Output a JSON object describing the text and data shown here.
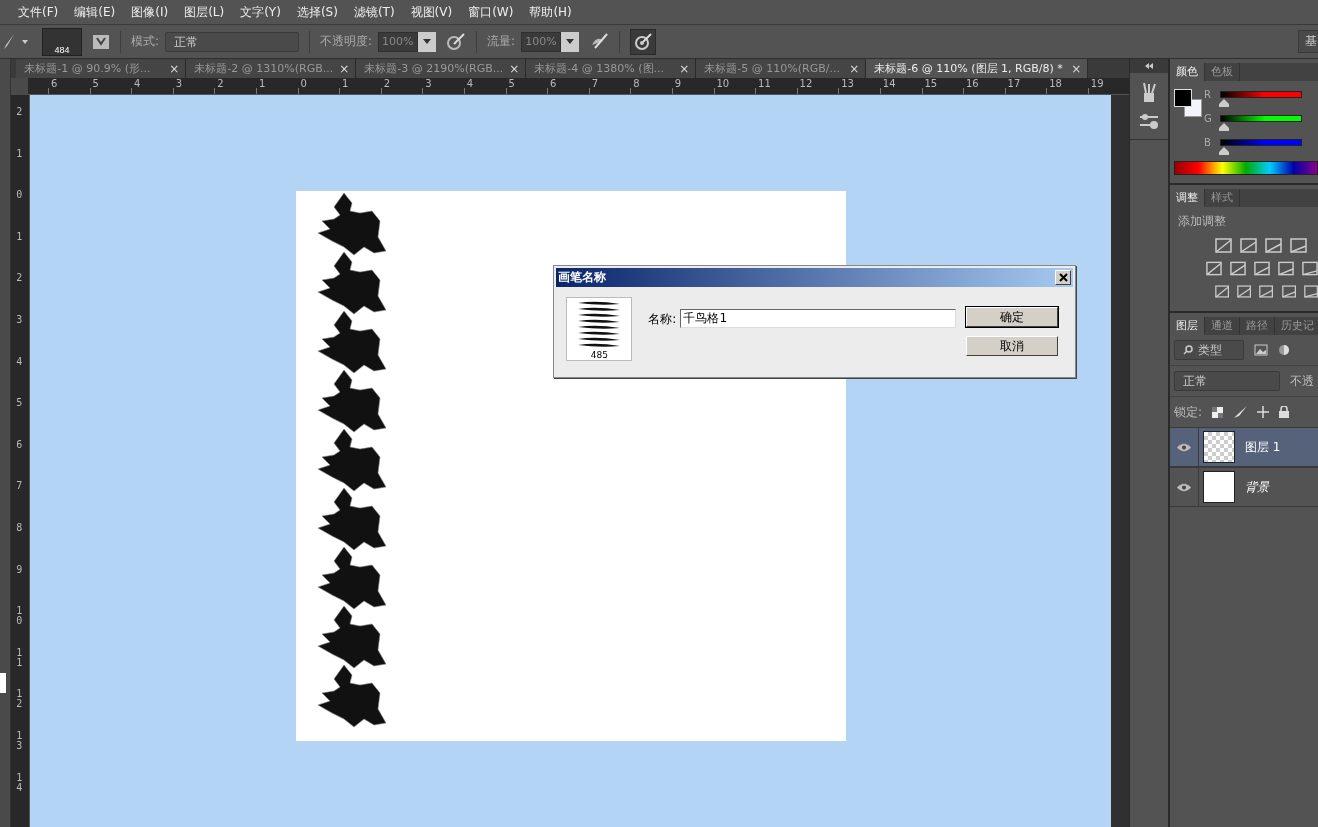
{
  "menu": [
    "文件(F)",
    "编辑(E)",
    "图像(I)",
    "图层(L)",
    "文字(Y)",
    "选择(S)",
    "滤镜(T)",
    "视图(V)",
    "窗口(W)",
    "帮助(H)"
  ],
  "options": {
    "brush_size": "484",
    "mode_label": "模式:",
    "mode": "正常",
    "opacity_label": "不透明度:",
    "opacity": "100%",
    "flow_label": "流量:",
    "flow": "100%",
    "workspace": "基"
  },
  "tabs": [
    {
      "label": "未标题-1 @ 90.9% (形...",
      "close": "×",
      "selected": false
    },
    {
      "label": "未标题-2 @ 1310%(RGB...",
      "close": "×",
      "selected": false
    },
    {
      "label": "未标题-3 @ 2190%(RGB...",
      "close": "×",
      "selected": false
    },
    {
      "label": "未标题-4 @ 1380% (图...",
      "close": "×",
      "selected": false
    },
    {
      "label": "未标题-5 @ 110%(RGB/...",
      "close": "×",
      "selected": false
    },
    {
      "label": "未标题-6 @ 110% (图层 1, RGB/8) *",
      "close": "×",
      "selected": true
    }
  ],
  "ruler": {
    "horizontal": [
      "6",
      "5",
      "4",
      "3",
      "2",
      "1",
      "0",
      "1",
      "2",
      "3",
      "4",
      "5",
      "6",
      "7",
      "8",
      "9",
      "10",
      "11",
      "12",
      "13",
      "14",
      "15",
      "16",
      "17",
      "18",
      "19"
    ],
    "vertical": [
      "2",
      "1",
      "0",
      "1",
      "2",
      "3",
      "4",
      "5",
      "6",
      "7",
      "8",
      "9",
      "10",
      "11",
      "12",
      "13",
      "14"
    ]
  },
  "dialog": {
    "title": "画笔名称",
    "preview_size": "485",
    "name_label": "名称:",
    "name_value": "千鸟格1",
    "buttons": [
      "确定",
      "取消"
    ]
  },
  "color_panel": {
    "tabs": [
      {
        "label": "颜色",
        "selected": true
      },
      {
        "label": "色板",
        "selected": false
      }
    ],
    "channels": [
      {
        "label": "R",
        "level": 0,
        "color": "#ff0000"
      },
      {
        "label": "G",
        "level": 0,
        "color": "#00ff00"
      },
      {
        "label": "B",
        "level": 0,
        "color": "#0000ff"
      }
    ]
  },
  "adjust_panel": {
    "tabs": [
      {
        "label": "调整",
        "selected": true
      },
      {
        "label": "样式",
        "selected": false
      }
    ],
    "title": "添加调整"
  },
  "layers_panel": {
    "tabs": [
      {
        "label": "图层",
        "selected": true
      },
      {
        "label": "通道",
        "selected": false
      },
      {
        "label": "路径",
        "selected": false
      },
      {
        "label": "历史记",
        "selected": false
      }
    ],
    "filter": "类型",
    "blend": "正常",
    "opacity_label": "不透",
    "lock_label": "锁定:",
    "layers": [
      {
        "name": "图层 1",
        "kind": "layer",
        "selected": true,
        "visible": true
      },
      {
        "name": "背景",
        "kind": "background",
        "selected": false,
        "visible": true
      }
    ]
  }
}
